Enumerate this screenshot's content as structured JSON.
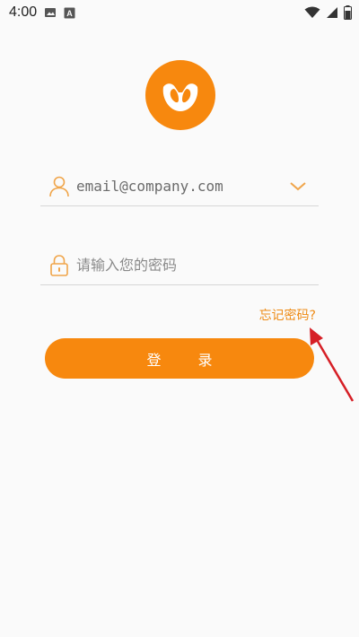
{
  "status_bar": {
    "time": "4:00",
    "left_icons": [
      "image-icon",
      "a-notification-icon"
    ],
    "right_icons": [
      "wifi-icon",
      "cellular-signal-icon",
      "battery-icon"
    ]
  },
  "login": {
    "email_value": "email@company.com",
    "password_placeholder": "请输入您的密码",
    "forgot_label": "忘记密码?",
    "submit_label": "登 录"
  },
  "colors": {
    "accent": "#f7880e",
    "forgot_text": "#ee8a14",
    "annotation_arrow": "#d61f26",
    "background": "#fafafa"
  }
}
